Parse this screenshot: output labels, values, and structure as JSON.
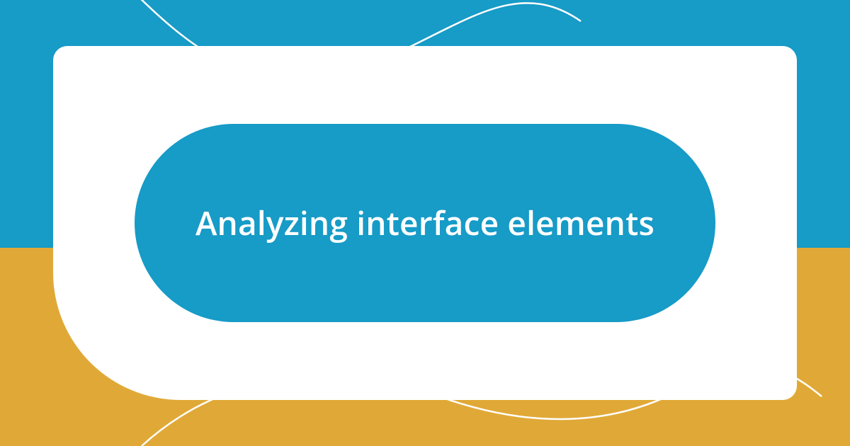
{
  "main": {
    "title": "Analyzing interface elements"
  },
  "colors": {
    "teal": "#179bc7",
    "gold": "#e0a937",
    "white": "#ffffff"
  }
}
